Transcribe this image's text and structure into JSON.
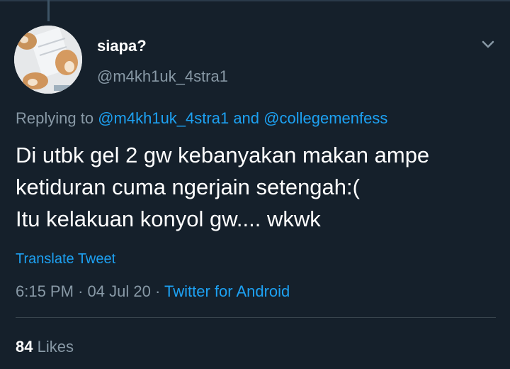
{
  "user": {
    "display_name": "siapa?",
    "handle": "@m4kh1uk_4stra1",
    "avatar_icon": "cat-photo-avatar"
  },
  "reply": {
    "prefix": "Replying to",
    "mention_1": "@m4kh1uk_4stra1",
    "conjunction": "and",
    "mention_2": "@collegemenfess"
  },
  "tweet": {
    "lines": [
      "Di utbk gel 2 gw kebanyakan makan ampe",
      "ketiduran cuma ngerjain setengah:(",
      "Itu kelakuan konyol gw.... wkwk"
    ]
  },
  "translate_label": "Translate Tweet",
  "meta": {
    "time": "6:15 PM",
    "date": "04 Jul 20",
    "separator": "·",
    "source": "Twitter for Android"
  },
  "stats": {
    "likes_count": "84",
    "likes_label": "Likes"
  },
  "colors": {
    "background": "#15202b",
    "text_primary": "#ffffff",
    "text_secondary": "#8899a6",
    "accent": "#1da1f2",
    "divider": "#38444d"
  }
}
